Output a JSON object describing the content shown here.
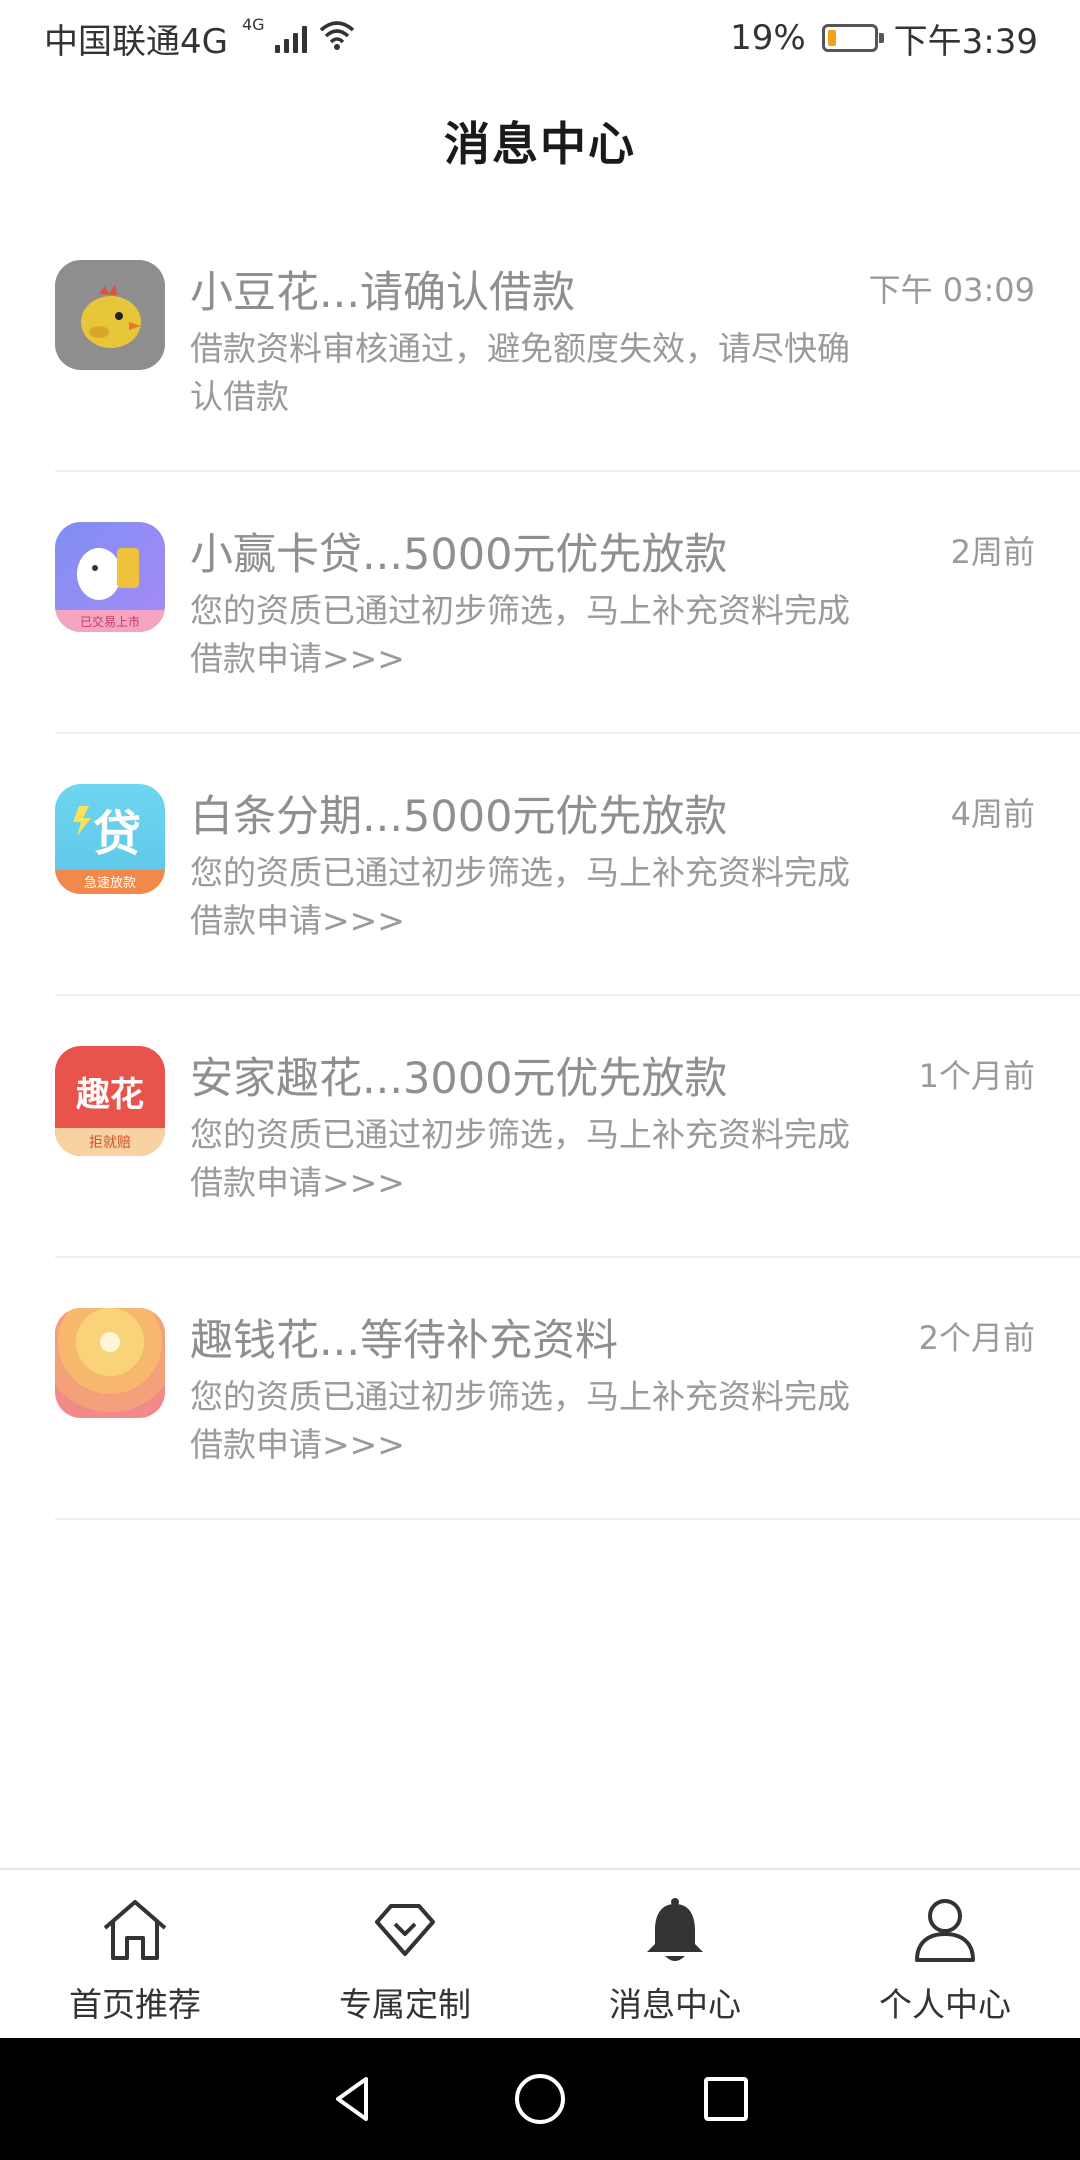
{
  "status_bar": {
    "carrier": "中国联通4G",
    "network_tag": "4G",
    "battery_percent": "19%",
    "battery_level": 0.19,
    "time": "下午3:39",
    "battery_color": "#f2a21a"
  },
  "header": {
    "title": "消息中心"
  },
  "messages": [
    {
      "title": "小豆花...请确认借款",
      "time": "下午 03:09",
      "body": "借款资料审核通过，避免额度失效，请尽快确认借款",
      "icon": "chick-app-icon"
    },
    {
      "title": "小赢卡贷...5000元优先放款",
      "time": "2周前",
      "body": "您的资质已通过初步筛选，马上补充资料完成借款申请>>>",
      "icon": "xiaoying-app-icon",
      "icon_badge": "已交易上市"
    },
    {
      "title": "白条分期...5000元优先放款",
      "time": "4周前",
      "body": "您的资质已通过初步筛选，马上补充资料完成借款申请>>>",
      "icon": "dai-app-icon",
      "icon_text": "贷",
      "icon_badge": "急速放款"
    },
    {
      "title": "安家趣花...3000元优先放款",
      "time": "1个月前",
      "body": "您的资质已通过初步筛选，马上补充资料完成借款申请>>>",
      "icon": "quhua-app-icon",
      "icon_text": "趣花",
      "icon_badge": "拒就赔"
    },
    {
      "title": "趣钱花...等待补充资料",
      "time": "2个月前",
      "body": "您的资质已通过初步筛选，马上补充资料完成借款申请>>>",
      "icon": "sunset-app-icon"
    }
  ],
  "bottom_nav": [
    {
      "label": "首页推荐",
      "icon": "home-icon"
    },
    {
      "label": "专属定制",
      "icon": "diamond-icon"
    },
    {
      "label": "消息中心",
      "icon": "bell-icon",
      "active": true
    },
    {
      "label": "个人中心",
      "icon": "person-icon"
    }
  ],
  "system_nav": [
    "back-icon",
    "home-circle-icon",
    "recents-icon"
  ]
}
